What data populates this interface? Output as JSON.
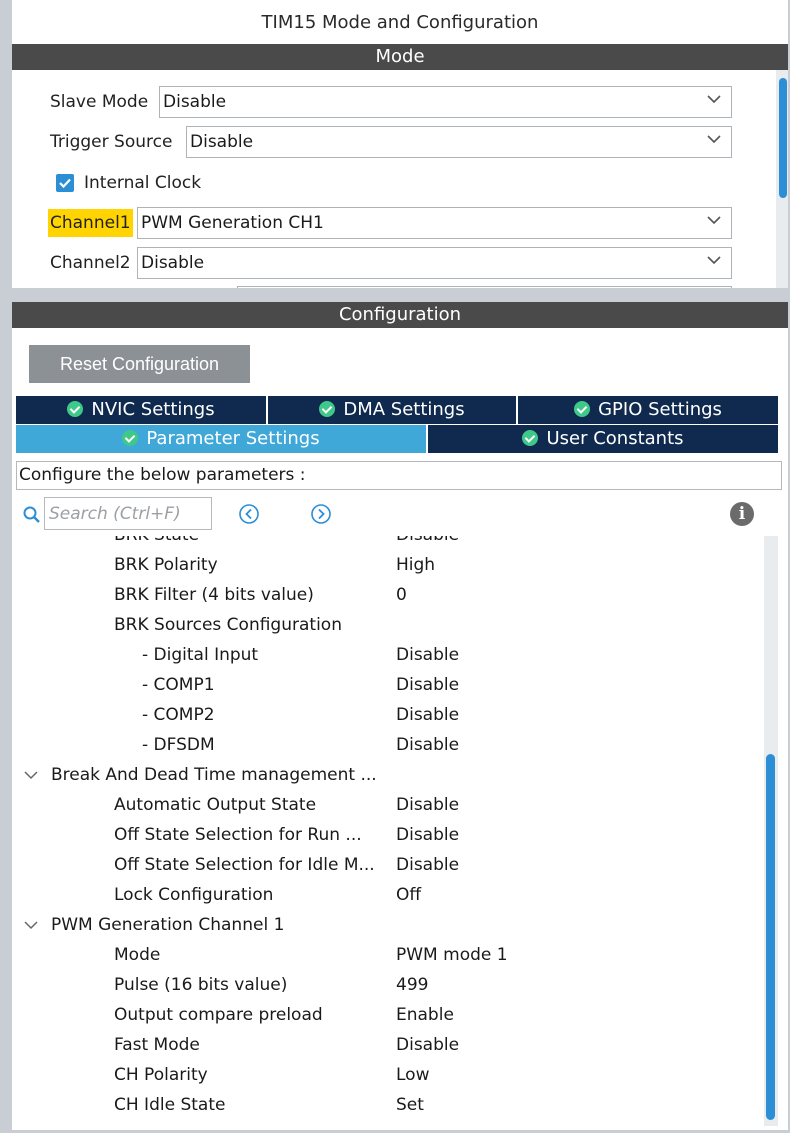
{
  "window": {
    "title": "TIM15 Mode and Configuration"
  },
  "mode": {
    "header": "Mode",
    "slave_mode": {
      "label": "Slave Mode",
      "value": "Disable"
    },
    "trigger_source": {
      "label": "Trigger Source",
      "value": "Disable"
    },
    "internal_clock": {
      "label": "Internal Clock",
      "checked": true
    },
    "channel1": {
      "label": "Channel1",
      "value": "PWM Generation CH1"
    },
    "channel2": {
      "label": "Channel2",
      "value": "Disable"
    }
  },
  "config": {
    "header": "Configuration",
    "reset_label": "Reset Configuration",
    "tabs": {
      "nvic": "NVIC Settings",
      "dma": "DMA Settings",
      "gpio": "GPIO Settings",
      "params": "Parameter Settings",
      "user": "User Constants"
    },
    "description": "Configure the below parameters :",
    "search_placeholder": "Search (Ctrl+F)"
  },
  "params": {
    "rows": [
      {
        "name": "BRK State",
        "value": "Disable"
      },
      {
        "name": "BRK Polarity",
        "value": "High"
      },
      {
        "name": "BRK Filter (4 bits value)",
        "value": "0"
      },
      {
        "name": "BRK Sources Configuration",
        "value": ""
      },
      {
        "name": "- Digital Input",
        "value": "Disable"
      },
      {
        "name": "- COMP1",
        "value": "Disable"
      },
      {
        "name": "- COMP2",
        "value": "Disable"
      },
      {
        "name": "- DFSDM",
        "value": "Disable"
      },
      {
        "name": "Break And Dead Time management ...",
        "value": ""
      },
      {
        "name": "Automatic Output State",
        "value": "Disable"
      },
      {
        "name": "Off State Selection for Run ...",
        "value": "Disable"
      },
      {
        "name": "Off State Selection for Idle M...",
        "value": "Disable"
      },
      {
        "name": "Lock Configuration",
        "value": "Off"
      },
      {
        "name": "PWM Generation Channel 1",
        "value": ""
      },
      {
        "name": "Mode",
        "value": "PWM mode 1"
      },
      {
        "name": "Pulse (16 bits value)",
        "value": "499"
      },
      {
        "name": "Output compare preload",
        "value": "Enable"
      },
      {
        "name": "Fast Mode",
        "value": "Disable"
      },
      {
        "name": "CH Polarity",
        "value": "Low"
      },
      {
        "name": "CH Idle State",
        "value": "Set"
      }
    ]
  },
  "colors": {
    "accent": "#2c8fd6",
    "tab_dark": "#0f2a4e",
    "tab_active": "#3fa8d8",
    "highlight": "#ffd400",
    "ok_icon": "#3ec98a"
  }
}
